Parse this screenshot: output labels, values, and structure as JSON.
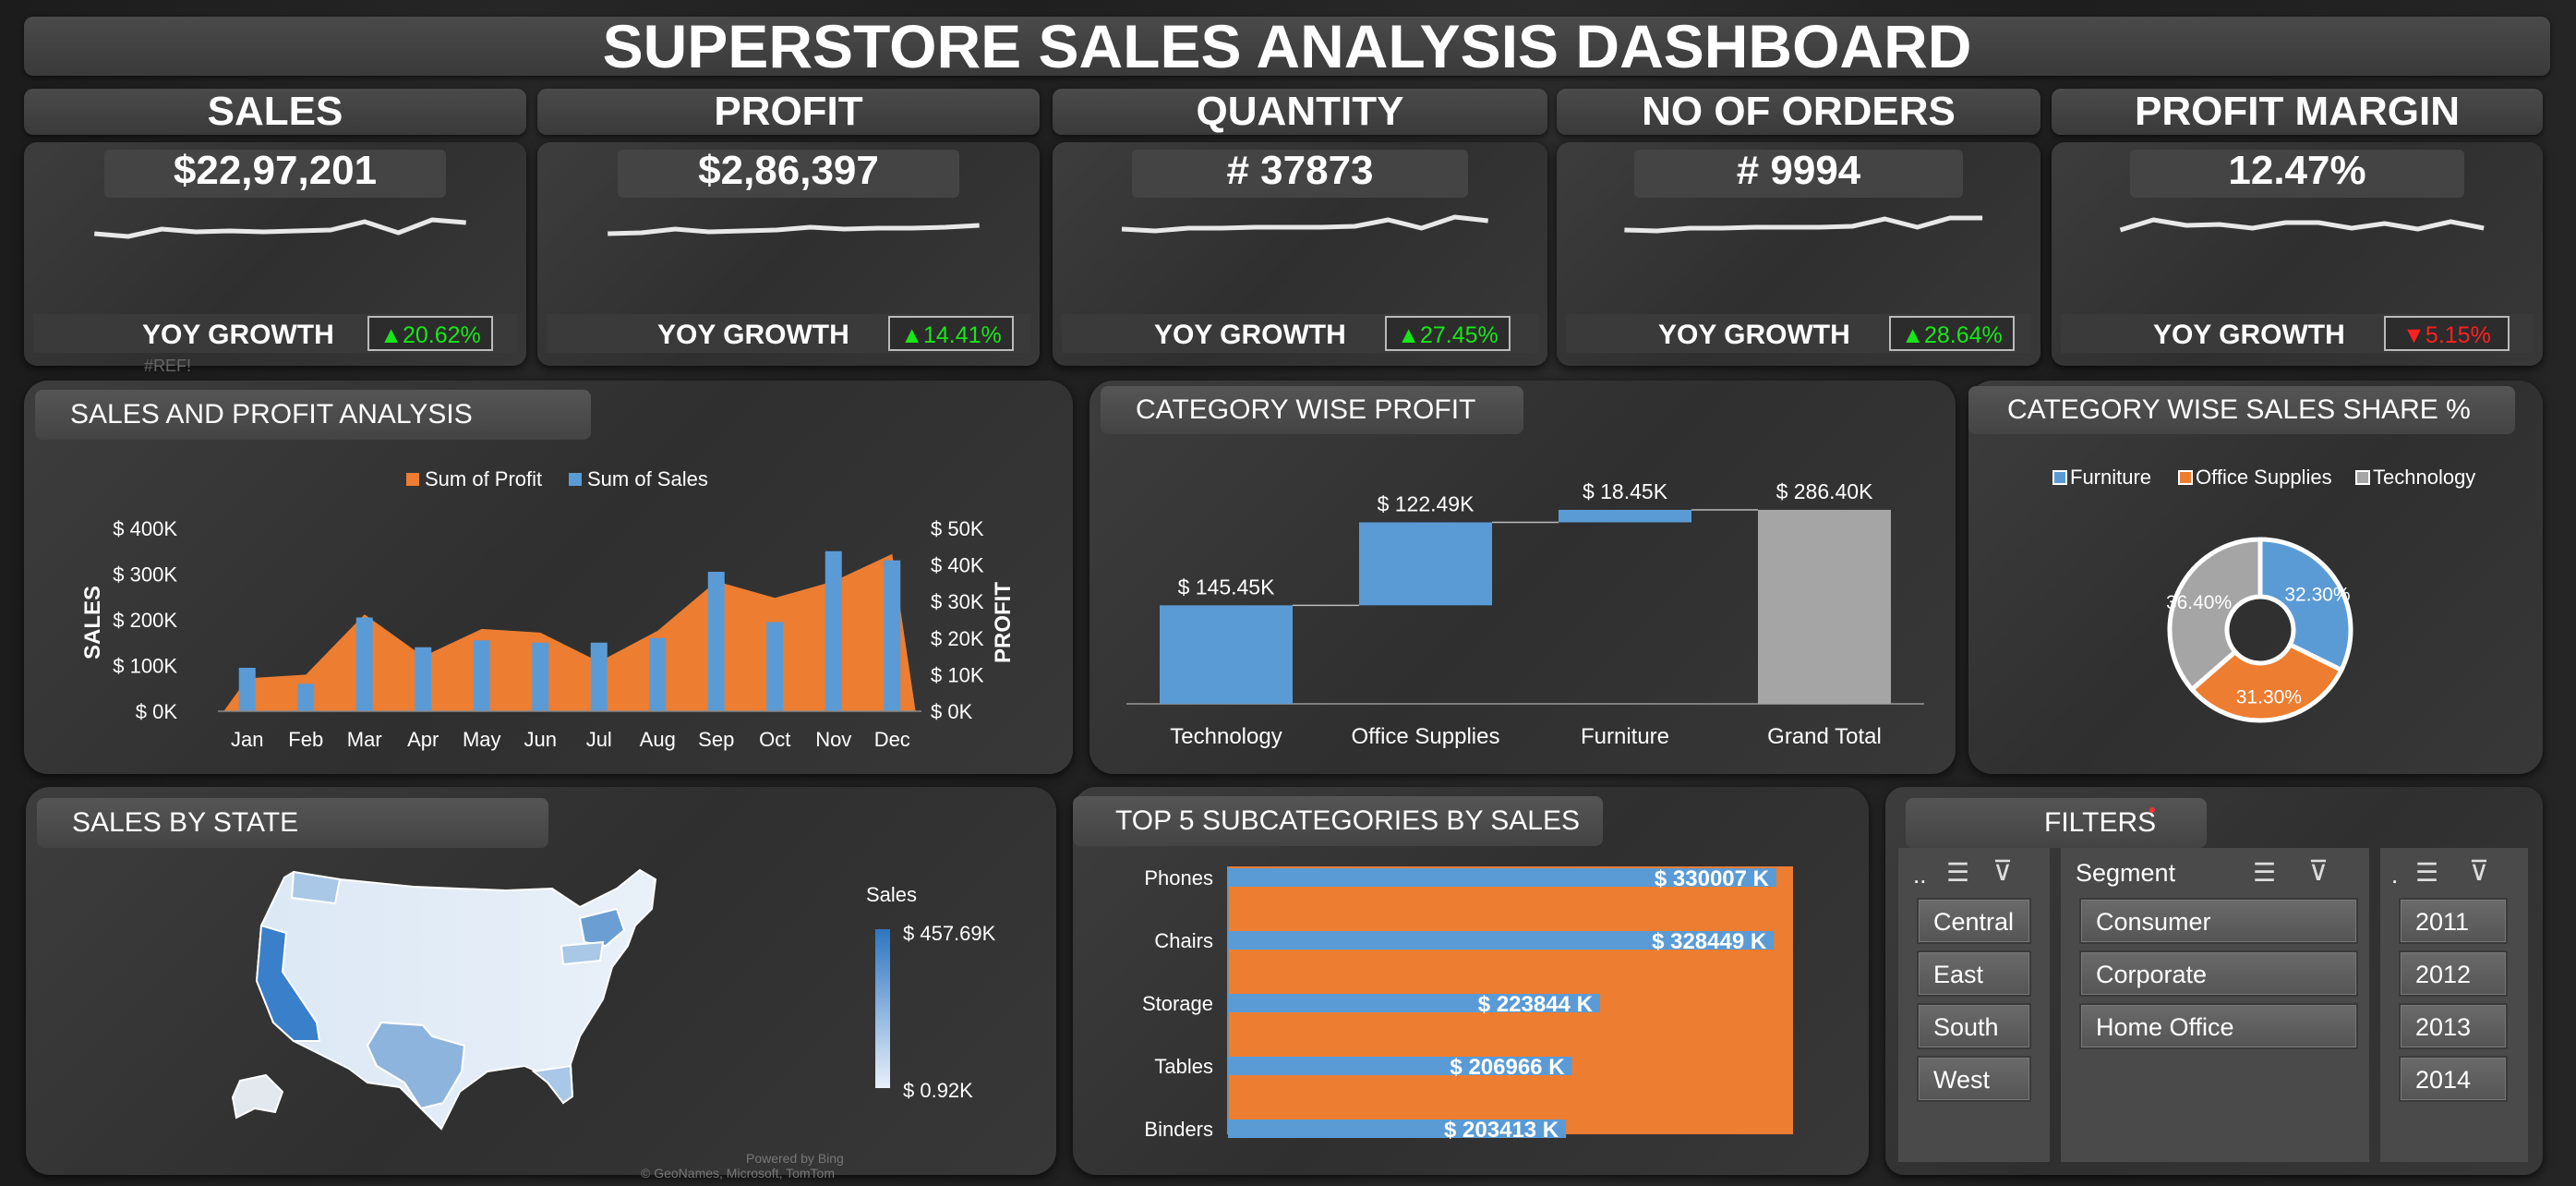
{
  "title": "SUPERSTORE SALES ANALYSIS DASHBOARD",
  "colors": {
    "profit": "#ED7D31",
    "sales": "#5B9BD5",
    "total": "#A5A5A5",
    "up": "#19e619",
    "down": "#ff2020"
  },
  "kpis": [
    {
      "label": "SALES",
      "value": "$22,97,201",
      "yoy_label": "YOY GROWTH",
      "yoy_value": "▲20.62%",
      "direction": "up"
    },
    {
      "label": "PROFIT",
      "value": "$2,86,397",
      "yoy_label": "YOY  GROWTH",
      "yoy_value": "▲14.41%",
      "direction": "up"
    },
    {
      "label": "QUANTITY",
      "value": "# 37873",
      "yoy_label": "YOY GROWTH",
      "yoy_value": "▲27.45%",
      "direction": "up"
    },
    {
      "label": "NO OF ORDERS",
      "value": "# 9994",
      "yoy_label": "YOY GROWTH",
      "yoy_value": "▲28.64%",
      "direction": "up"
    },
    {
      "label": "PROFIT MARGIN",
      "value": "12.47%",
      "yoy_label": "YOY GROWTH",
      "yoy_value": "▼5.15%",
      "direction": "down"
    }
  ],
  "kpi_ref_text": "#REF!",
  "sections": {
    "sales_profit": "SALES AND PROFIT ANALYSIS",
    "category_profit": "CATEGORY WISE PROFIT",
    "category_share": "CATEGORY WISE SALES SHARE %",
    "sales_by_state": "SALES BY STATE",
    "top5": "TOP 5 SUBCATEGORIES BY SALES",
    "filters": "FILTERS"
  },
  "map": {
    "legend_title": "Sales",
    "legend_max": "$ 457.69K",
    "legend_min": "$ 0.92K",
    "credit1": "Powered by Bing",
    "credit2": "© GeoNames, Microsoft, TomTom"
  },
  "slicers": {
    "region": {
      "header": "..",
      "items": [
        "Central",
        "East",
        "South",
        "West"
      ]
    },
    "segment": {
      "header": "Segment",
      "items": [
        "Consumer",
        "Corporate",
        "Home Office"
      ]
    },
    "year": {
      "header": ".",
      "items": [
        "2011",
        "2012",
        "2013",
        "2014"
      ]
    }
  },
  "chart_data": [
    {
      "type": "line",
      "title": "",
      "note": "KPI sparklines (monthly trend, no axes)",
      "series": [
        {
          "name": "",
          "values": [
            45,
            42,
            50,
            47,
            48,
            47,
            48,
            49,
            58,
            46,
            60,
            57
          ]
        },
        {
          "name": "",
          "values": [
            45,
            46,
            50,
            47,
            48,
            49,
            52,
            50,
            51,
            51,
            52,
            54
          ]
        },
        {
          "name": "",
          "values": [
            50,
            48,
            51,
            51,
            52,
            52,
            52,
            53,
            60,
            51,
            63,
            59
          ]
        },
        {
          "name": "",
          "values": [
            49,
            48,
            51,
            51,
            52,
            52,
            52,
            53,
            61,
            52,
            62,
            62
          ]
        },
        {
          "name": "",
          "values": [
            49,
            60,
            54,
            55,
            51,
            57,
            57,
            51,
            56,
            50,
            58,
            51
          ]
        }
      ]
    },
    {
      "type": "bar",
      "title": "",
      "categories": [
        "Jan",
        "Feb",
        "Mar",
        "Apr",
        "May",
        "Jun",
        "Jul",
        "Aug",
        "Sep",
        "Oct",
        "Nov",
        "Dec"
      ],
      "series": [
        {
          "name": "Sum of Profit",
          "type": "area",
          "axis": "right",
          "values": [
            9000,
            10000,
            26500,
            15000,
            22500,
            21500,
            13500,
            22000,
            35500,
            31000,
            35500,
            43000
          ]
        },
        {
          "name": "Sum of Sales",
          "type": "bar",
          "axis": "left",
          "values": [
            95000,
            60000,
            205000,
            140000,
            155000,
            150000,
            150000,
            160000,
            305000,
            195000,
            350000,
            330000
          ]
        }
      ],
      "ylabel": "SALES",
      "y2label": "PROFIT",
      "ylim": [
        0,
        400000
      ],
      "y2lim": [
        0,
        50000
      ],
      "yticks": [
        "$ 0K",
        "$ 100K",
        "$ 200K",
        "$ 300K",
        "$ 400K"
      ],
      "y2ticks": [
        "$ 0K",
        "$ 10K",
        "$ 20K",
        "$ 30K",
        "$ 40K",
        "$ 50K"
      ],
      "legend": "top"
    },
    {
      "type": "bar",
      "subtype": "waterfall",
      "title": "",
      "categories": [
        "Technology",
        "Office Supplies",
        "Furniture",
        "Grand Total"
      ],
      "values": [
        145.45,
        122.49,
        18.45,
        286.4
      ],
      "labels": [
        "$ 145.45K",
        "$ 122.49K",
        "$ 18.45K",
        "$ 286.40K"
      ],
      "unit": "K"
    },
    {
      "type": "pie",
      "subtype": "donut",
      "title": "",
      "categories": [
        "Furniture",
        "Office Supplies",
        "Technology"
      ],
      "values": [
        32.3,
        31.3,
        36.4
      ],
      "labels": [
        "32.30%",
        "31.30%",
        "36.40%"
      ],
      "legend": "top"
    },
    {
      "type": "bar",
      "orientation": "horizontal",
      "title": "",
      "categories": [
        "Phones",
        "Chairs",
        "Storage",
        "Tables",
        "Binders"
      ],
      "values": [
        330007,
        328449,
        223844,
        206966,
        203413
      ],
      "labels": [
        "$ 330007 K",
        "$ 328449 K",
        "$ 223844 K",
        "$ 206966 K",
        "$ 203413 K"
      ],
      "xlim": [
        0,
        340000
      ]
    }
  ]
}
